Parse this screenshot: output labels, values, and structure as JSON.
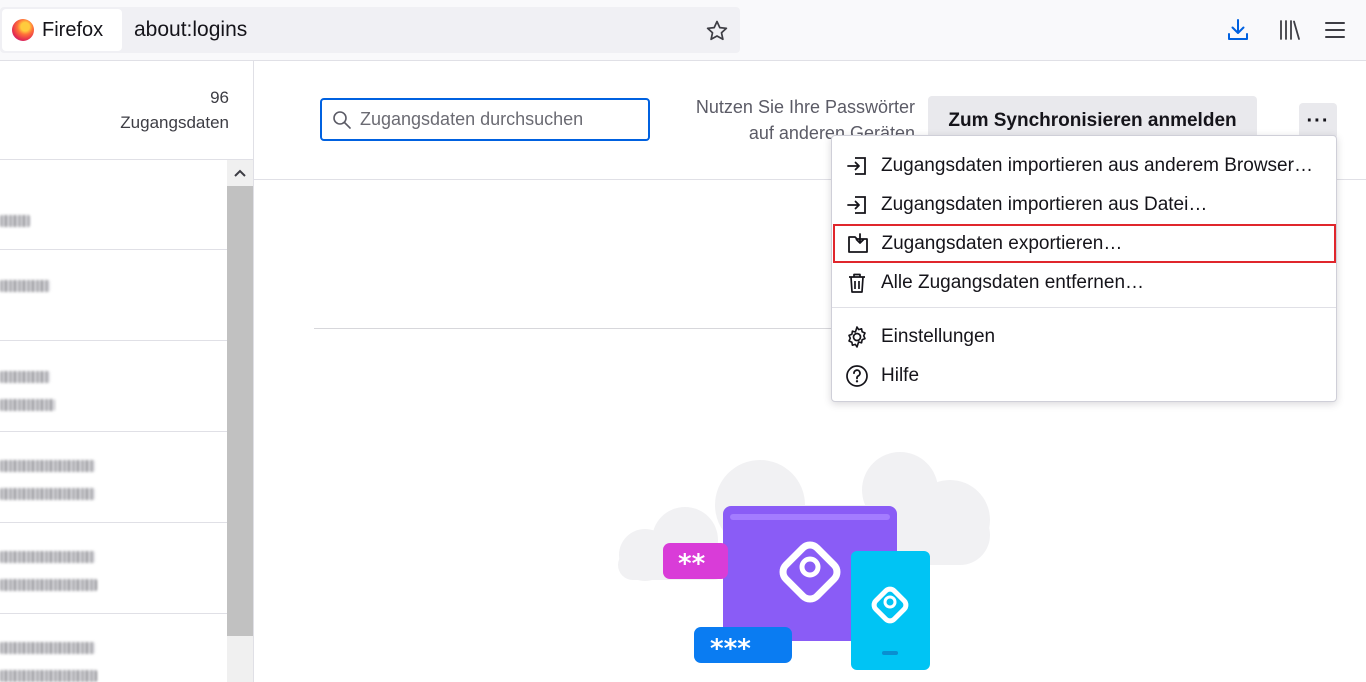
{
  "browser": {
    "identity_label": "Firefox",
    "url": "about:logins"
  },
  "sidebar": {
    "count": "96",
    "count_label": "Zugangsdaten"
  },
  "header": {
    "search_placeholder": "Zugangsdaten durchsuchen",
    "sync_text_line1": "Nutzen Sie Ihre Passwörter",
    "sync_text_line2": "auf anderen Geräten",
    "sync_button": "Zum Synchronisieren anmelden",
    "menu_button": "···"
  },
  "menu": {
    "items": [
      {
        "label": "Zugangsdaten importieren aus anderem Browser…",
        "icon": "import-icon"
      },
      {
        "label": "Zugangsdaten importieren aus Datei…",
        "icon": "import-icon"
      },
      {
        "label": "Zugangsdaten exportieren…",
        "icon": "export-folder-icon",
        "highlighted": true
      },
      {
        "label": "Alle Zugangsdaten entfernen…",
        "icon": "trash-icon"
      },
      {
        "label": "Einstellungen",
        "icon": "gear-icon"
      },
      {
        "label": "Hilfe",
        "icon": "help-icon"
      }
    ]
  },
  "illustration": {
    "pw_left": "**",
    "pw_bottom": "***"
  },
  "colors": {
    "accent": "#0061e0",
    "highlight_border": "#e0262c",
    "purple": "#9059ff",
    "cyan": "#00b3f4"
  }
}
